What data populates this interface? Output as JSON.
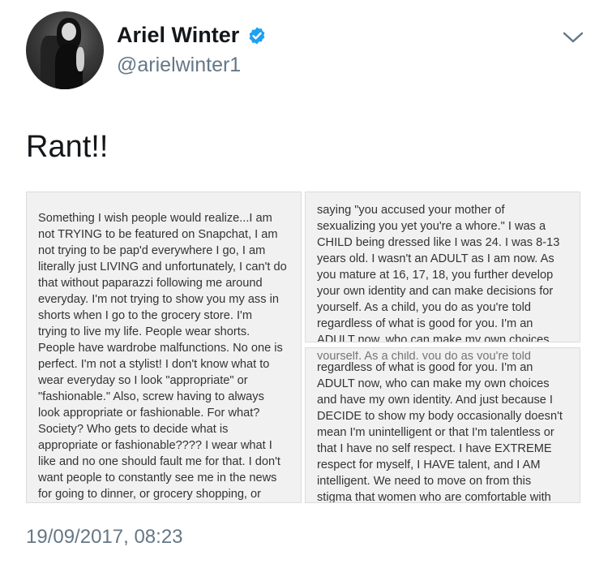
{
  "user": {
    "display_name": "Ariel Winter",
    "handle": "@arielwinter1",
    "verified": true
  },
  "tweet": {
    "text": "Rant!!",
    "timestamp": "19/09/2017, 08:23"
  },
  "image_panels": {
    "left": "Something I wish people would realize...I am\nnot TRYING to be featured on Snapchat, I am\nnot trying to be pap'd everywhere I go, I am\nliterally just LIVING and unfortunately, I can't do\nthat without paparazzi following me around\neveryday. I'm not trying to show you my ass in\nshorts when I go to the grocery store. I'm\ntrying to live my life. People wear shorts.\nPeople have wardrobe malfunctions. No one is\nperfect. I'm not a stylist! I don't know what to\nwear everyday so I look \"appropriate\" or\n\"fashionable.\" Also, screw having to always\nlook appropriate or fashionable. For what?\nSociety? Who gets to decide what is\nappropriate or fashionable???? I wear what I\nlike and no one should fault me for that. I don't\nwant people to constantly see me in the news\nfor going to dinner, or grocery shopping, or",
    "right_top": "saying \"you accused your mother of\nsexualizing you yet you're a whore.\" I was a\nCHILD being dressed like I was 24. I was 8-13\nyears old. I wasn't an ADULT as I am now. As\nyou mature at 16, 17, 18, you further develop\nyour own identity and can make decisions for\nyourself. As a child, you do as you're told\nregardless of what is good for you. I'm an\nADULT now, who can make my own choices",
    "right_bottom_cut": "yourself. As a child, you do as you're told",
    "right_bottom": "regardless of what is good for you. I'm an\nADULT now, who can make my own choices\nand have my own identity. And just because I\nDECIDE to show my body occasionally doesn't\nmean I'm unintelligent or that I'm talentless or\nthat I have no self respect. I have EXTREME\nrespect for myself, I HAVE talent, and I AM\nintelligent. We need to move on from this\nstigma that women who are comfortable with"
  },
  "colors": {
    "verified_blue": "#1da1f2",
    "secondary_text": "#657786",
    "panel_bg": "#f1f1f1"
  },
  "icons": {
    "verified": "verified-badge-icon",
    "menu": "chevron-down-icon"
  }
}
